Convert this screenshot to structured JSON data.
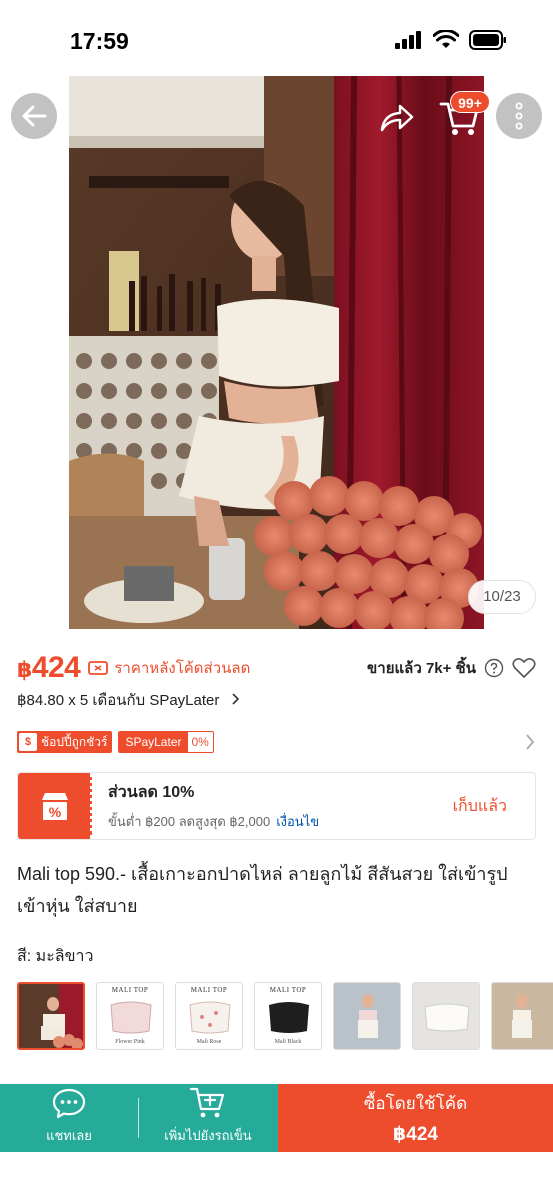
{
  "status_bar": {
    "time": "17:59"
  },
  "gallery": {
    "page_indicator": "10/23",
    "cart_badge": "99+"
  },
  "price": {
    "currency": "฿",
    "amount": "424",
    "note": "ราคาหลังโค้ดส่วนลด",
    "sold": "ขายแล้ว 7k+ ชิ้น"
  },
  "installment": "฿84.80 x 5 เดือนกับ SPayLater",
  "badges": {
    "mall_label": "ช้อปปี้ถูกชัวร์",
    "spay_label": "SPayLater",
    "spay_rate": "0%"
  },
  "voucher": {
    "title": "ส่วนลด 10%",
    "condition": "ขั้นต่ำ ฿200 ลดสูงสุด ฿2,000",
    "condition_link": "เงื่อนไข",
    "claim_label": "เก็บแล้ว"
  },
  "product_title": "Mali top 590.- เสื้อเกาะอกปาดไหล่ ลายลูกไม้ สีสันสวย ใส่เข้ารูป เข้าหุ่น ใส่สบาย",
  "variant": {
    "label": "สี: มะลิขาว",
    "thumbnails": [
      {
        "caption": "",
        "sub": ""
      },
      {
        "caption": "MALI TOP",
        "sub": "Flower Pink"
      },
      {
        "caption": "MALI TOP",
        "sub": "Mali Rose"
      },
      {
        "caption": "MALI TOP",
        "sub": "Mali Black"
      },
      {
        "caption": "",
        "sub": ""
      },
      {
        "caption": "",
        "sub": ""
      },
      {
        "caption": "",
        "sub": ""
      }
    ]
  },
  "bottom_bar": {
    "chat_label": "แชทเลย",
    "add_cart_label": "เพิ่มไปยังรถเข็น",
    "buy_label": "ซื้อโดยใช้โค้ด",
    "buy_price": "฿424"
  },
  "colors": {
    "accent": "#ee4d2d",
    "teal": "#26aa99",
    "link": "#0055aa"
  }
}
